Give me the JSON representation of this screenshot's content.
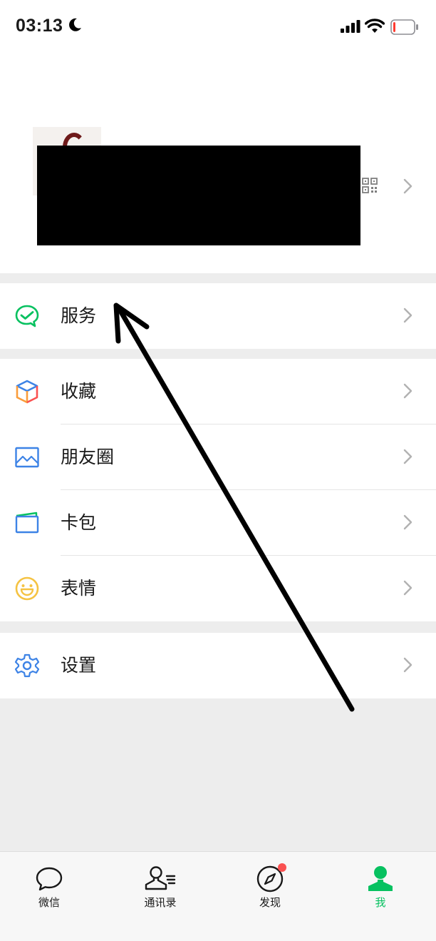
{
  "status_bar": {
    "time": "03:13",
    "icons": [
      "moon-icon",
      "signal-icon",
      "wifi-icon",
      "battery-icon"
    ],
    "battery_level": 0.1
  },
  "profile": {
    "name_redacted": true,
    "icons": [
      "qr-code-icon",
      "chevron-right-icon"
    ]
  },
  "menu_groups": [
    [
      {
        "label": "服务",
        "icon": "wechat-pay-icon",
        "color": "#07c160"
      }
    ],
    [
      {
        "label": "收藏",
        "icon": "favorites-cube-icon",
        "color": "#fa9d3b"
      },
      {
        "label": "朋友圈",
        "icon": "moments-image-icon",
        "color": "#3d83e6"
      },
      {
        "label": "卡包",
        "icon": "card-wallet-icon",
        "color": "#3d83e6"
      },
      {
        "label": "表情",
        "icon": "sticker-smile-icon",
        "color": "#f5c343"
      }
    ],
    [
      {
        "label": "设置",
        "icon": "settings-gear-icon",
        "color": "#3d83e6"
      }
    ]
  ],
  "tabbar": {
    "tabs": [
      {
        "label": "微信",
        "icon": "chat-bubble-icon",
        "active": false
      },
      {
        "label": "通讯录",
        "icon": "contacts-icon",
        "active": false
      },
      {
        "label": "发现",
        "icon": "discover-compass-icon",
        "active": false,
        "badge": "dot"
      },
      {
        "label": "我",
        "icon": "me-person-icon",
        "active": true
      }
    ],
    "active_color": "#07c160"
  },
  "annotation": {
    "type": "arrow",
    "color": "#000000"
  }
}
